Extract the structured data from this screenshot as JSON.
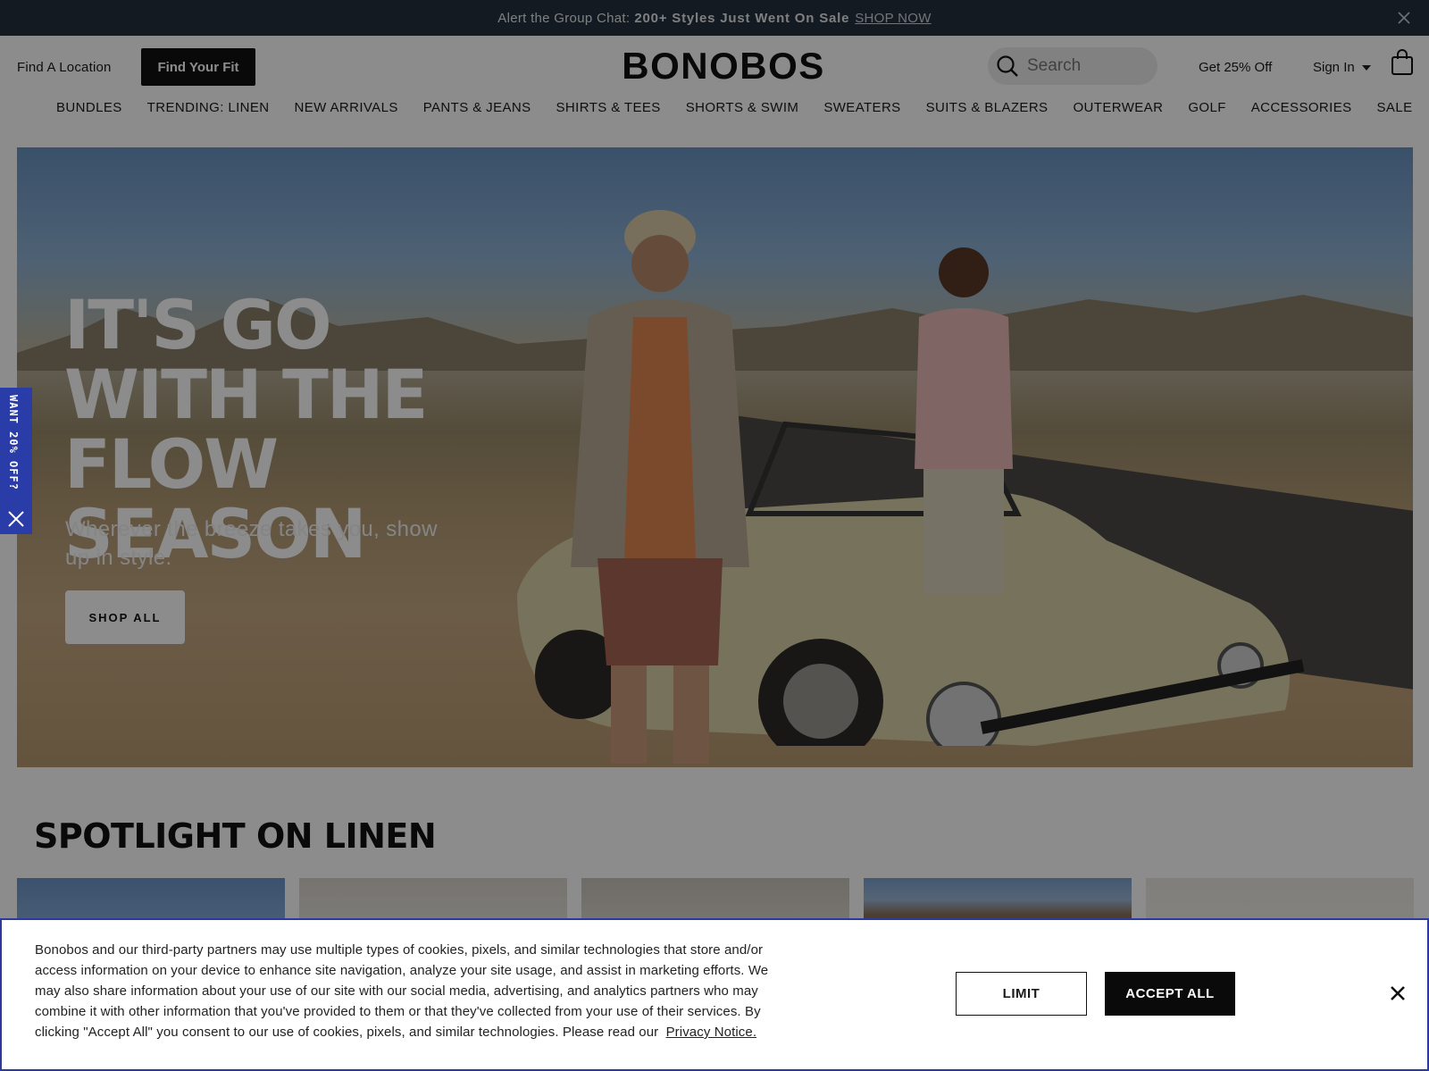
{
  "announcement": {
    "text": "Alert the Group Chat:",
    "bold_text": "200+ Styles Just Went On Sale",
    "link": "SHOP NOW"
  },
  "header": {
    "find_location": "Find A Location",
    "find_fit": "Find Your Fit",
    "logo": "BONOBOS",
    "search_placeholder": "Search",
    "get_off": "Get 25% Off",
    "sign_in": "Sign In"
  },
  "nav": {
    "items": [
      "BUNDLES",
      "TRENDING: LINEN",
      "NEW ARRIVALS",
      "PANTS & JEANS",
      "SHIRTS & TEES",
      "SHORTS & SWIM",
      "SWEATERS",
      "SUITS & BLAZERS",
      "OUTERWEAR",
      "GOLF",
      "ACCESSORIES",
      "SALE"
    ]
  },
  "hero": {
    "headline": "IT'S GO WITH THE FLOW SEASON",
    "subtitle": "Wherever the breeze takes you, show up in style.",
    "cta": "SHOP ALL"
  },
  "side_tab": {
    "label": "WANT 20% OFF?"
  },
  "spotlight": {
    "title": "SPOTLIGHT ON LINEN"
  },
  "cookie_banner": {
    "text": "Bonobos and our third-party partners may use multiple types of cookies, pixels, and similar technologies that store and/or access information on your device to enhance site navigation, analyze your site usage, and assist in marketing efforts. We may also share information about your use of our site with our social media, advertising, and analytics partners who may combine it with other information that you've provided to them or that they've collected from your use of their services. By clicking \"Accept All\" you consent to our use of cookies, pixels, and similar technologies. Please read our",
    "link": "Privacy Notice.",
    "limit": "LIMIT",
    "accept": "ACCEPT ALL"
  },
  "colors": {
    "announcement_bg": "#25313f",
    "side_tab_bg": "#2a3ca8",
    "button_dark": "#111111"
  }
}
